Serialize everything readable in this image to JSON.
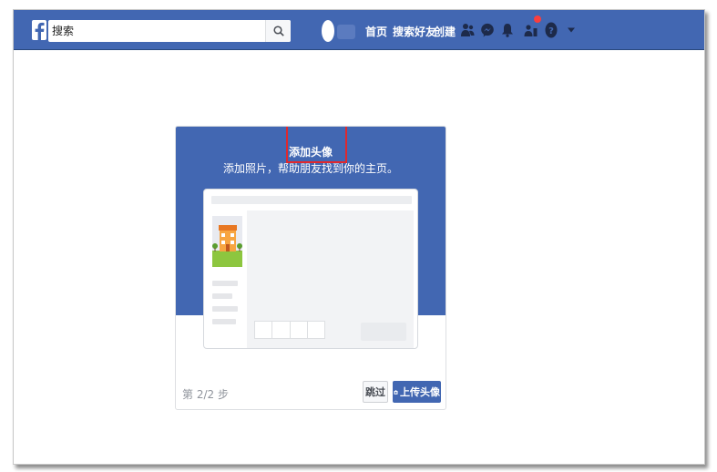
{
  "topbar": {
    "search_placeholder": "搜索",
    "nav": {
      "home": "首页",
      "find_friends": "搜索好友",
      "create": "创建"
    }
  },
  "card": {
    "title": "添加头像",
    "subtitle": "添加照片，帮助朋友找到你的主页。",
    "step": "第 2/2 步",
    "skip_label": "跳过",
    "upload_label": "上传头像"
  },
  "colors": {
    "brand": "#4267b2",
    "notification": "#fa3e3e",
    "highlight": "#e0282d"
  },
  "icons": [
    "facebook-logo-icon",
    "search-icon",
    "friends-icon",
    "messenger-icon",
    "bell-icon",
    "quick-help-icon",
    "help-icon",
    "dropdown-arrow-icon",
    "camera-icon"
  ]
}
